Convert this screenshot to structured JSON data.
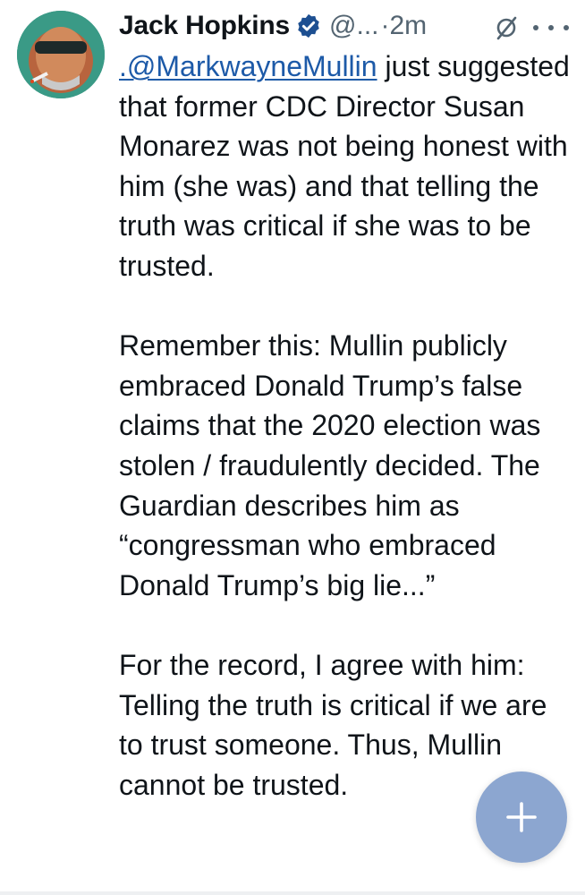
{
  "tweet": {
    "author_name": "Jack Hopkins",
    "handle": "@...",
    "separator": "·",
    "time": "2m",
    "mention": ".@MarkwayneMullin",
    "para1_rest": " just suggested that former CDC Director Susan Monarez was not being honest with him (she was) and that telling the truth was critical if she was to be trusted.",
    "para2": "Remember this: Mullin publicly embraced Donald Trump’s false claims that the 2020 election was stolen / fraudulently decided. The Guardian describes him as “congressman who embraced Donald Trump’s big lie...”",
    "para3": "For the record, I agree with him: Telling the truth is critical if we are to trust someone. Thus, Mullin cannot be trusted."
  },
  "colors": {
    "link": "#1d5aa8",
    "verified": "#1d4f91",
    "secondary_text": "#536471",
    "fab": "#7896c8"
  },
  "icons": [
    "avatar",
    "verified-badge-icon",
    "grok-icon",
    "more-icon",
    "compose-plus-icon"
  ]
}
